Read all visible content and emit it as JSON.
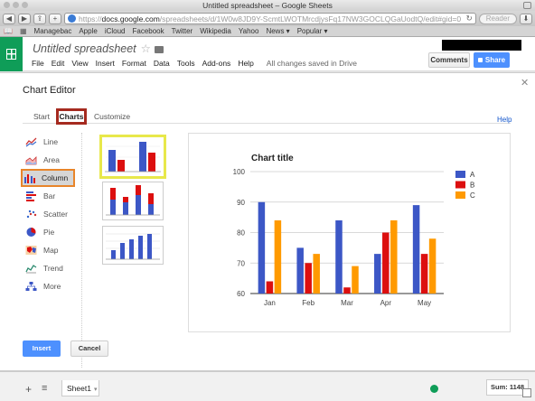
{
  "browser": {
    "window_title": "Untitled spreadsheet – Google Sheets",
    "url_prefix": "https://",
    "url_host": "docs.google.com",
    "url_path": "/spreadsheets/d/1W0w8JD9Y-ScmtLWOTMrcdjysFq17NW3GOCLQGaUodtQ/edit#gid=0",
    "reader_label": "Reader",
    "bookmarks": [
      "Managebac",
      "Apple",
      "iCloud",
      "Facebook",
      "Twitter",
      "Wikipedia",
      "Yahoo",
      "News ▾",
      "Popular ▾"
    ]
  },
  "sheets": {
    "doc_title": "Untitled spreadsheet",
    "menu": [
      "File",
      "Edit",
      "View",
      "Insert",
      "Format",
      "Data",
      "Tools",
      "Add-ons",
      "Help"
    ],
    "save_status": "All changes saved in Drive",
    "comments_label": "Comments",
    "share_label": "Share"
  },
  "dialog": {
    "title": "Chart Editor",
    "tabs": [
      "Start",
      "Charts",
      "Customize"
    ],
    "help_label": "Help",
    "chart_types": [
      "Line",
      "Area",
      "Column",
      "Bar",
      "Scatter",
      "Pie",
      "Map",
      "Trend",
      "More"
    ],
    "selected_type": "Column",
    "insert_label": "Insert",
    "cancel_label": "Cancel"
  },
  "bottom": {
    "sheet_name": "Sheet1",
    "sum_label": "Sum: 1148"
  },
  "colors": {
    "series_a": "#3c57c6",
    "series_b": "#dc0f0f",
    "series_c": "#ff9a00",
    "accent_blue": "#4d90fe"
  },
  "chart_data": {
    "type": "bar",
    "title": "Chart title",
    "categories": [
      "Jan",
      "Feb",
      "Mar",
      "Apr",
      "May"
    ],
    "series": [
      {
        "name": "A",
        "values": [
          90,
          75,
          84,
          73,
          89
        ]
      },
      {
        "name": "B",
        "values": [
          64,
          70,
          62,
          80,
          73
        ]
      },
      {
        "name": "C",
        "values": [
          84,
          73,
          69,
          84,
          78
        ]
      }
    ],
    "ylim": [
      60,
      100
    ],
    "yticks": [
      60,
      70,
      80,
      90,
      100
    ],
    "grid": true,
    "legend": "right"
  }
}
